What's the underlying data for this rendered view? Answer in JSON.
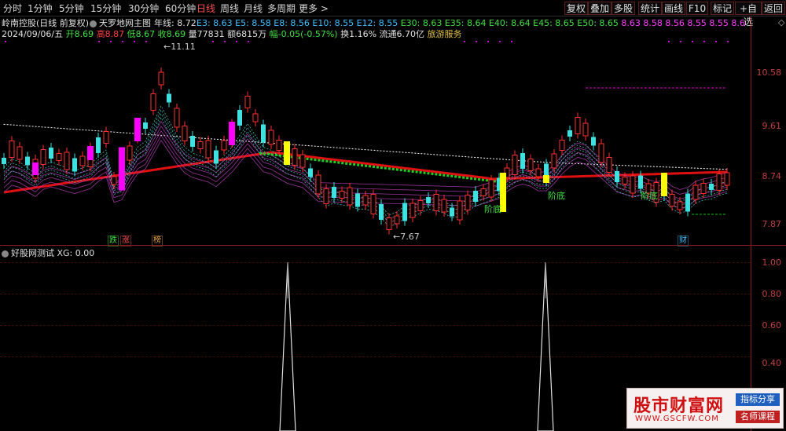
{
  "toolbar": {
    "timeframes": [
      "分时",
      "1分钟",
      "5分钟",
      "15分钟",
      "30分钟",
      "60分钟",
      "日线",
      "周线",
      "月线",
      "多周期",
      "更多 >"
    ],
    "active": "日线",
    "right_buttons": [
      "复权",
      "叠加",
      "多股",
      "统计",
      "画线",
      "F10",
      "标记",
      "+自选",
      "返回"
    ]
  },
  "header": {
    "stock": "岭南控股(日线 前复权)",
    "indicator": "天罗地网主图",
    "annual": "年线: 8.72",
    "emas": [
      {
        "t": "E3: 8.63",
        "c": "#40c0ff"
      },
      {
        "t": "E5: 8.58",
        "c": "#40c0ff"
      },
      {
        "t": "E8: 8.56",
        "c": "#40c0ff"
      },
      {
        "t": "E10: 8.55",
        "c": "#40c0ff"
      },
      {
        "t": "E12: 8.55",
        "c": "#40c0ff"
      },
      {
        "t": "E30: 8.63",
        "c": "#40e040"
      },
      {
        "t": "E35: 8.64",
        "c": "#40e040"
      },
      {
        "t": "E40: 8.64",
        "c": "#40e040"
      },
      {
        "t": "E45: 8.65",
        "c": "#40e040"
      },
      {
        "t": "E50: 8.65",
        "c": "#40e040"
      },
      {
        "t": "8.63",
        "c": "#ff40ff"
      },
      {
        "t": "8.58",
        "c": "#ff40ff"
      },
      {
        "t": "8.56",
        "c": "#ff40ff"
      },
      {
        "t": "8.55",
        "c": "#ff40ff"
      },
      {
        "t": "8.55",
        "c": "#ff40ff"
      },
      {
        "t": "8.6",
        "c": "#ff40ff"
      }
    ]
  },
  "quote": {
    "date": "2024/09/06/五",
    "open": "开8.69",
    "high": "高8.87",
    "low": "低8.67",
    "close": "收8.69",
    "volume": "量77831",
    "amount": "额6815万",
    "change": "幅-0.05(-0.57%)",
    "turnover": "换1.16%",
    "float": "流通6.70亿",
    "sector": "旅游服务"
  },
  "price_axis": [
    "10.58",
    "9.61",
    "8.74",
    "7.87"
  ],
  "annotations": {
    "high": "11.11",
    "low": "7.67",
    "bottom1": "阶底",
    "bottom2": "阶底",
    "bottom3": "阶底"
  },
  "markers": {
    "m1": "跌",
    "m2": "涨",
    "m3": "榜",
    "m4": "财"
  },
  "sub_panel": {
    "title": "好股网测试 XG: 0.00",
    "axis": [
      "1.00",
      "0.80",
      "0.60",
      "0.40"
    ],
    "spikes": [
      "1.00",
      "1.00"
    ]
  },
  "watermark": {
    "title": "股市财富网",
    "url": "WWW.GSCFW.COM",
    "tag1": "指标分享",
    "tag2": "名师课程"
  },
  "colors": {
    "up": "#ff3030",
    "down": "#40e0e0",
    "pink": "#ff00ff",
    "yellow": "#ffff00",
    "green": "#00c000",
    "axis": "#8b1a1a"
  }
}
